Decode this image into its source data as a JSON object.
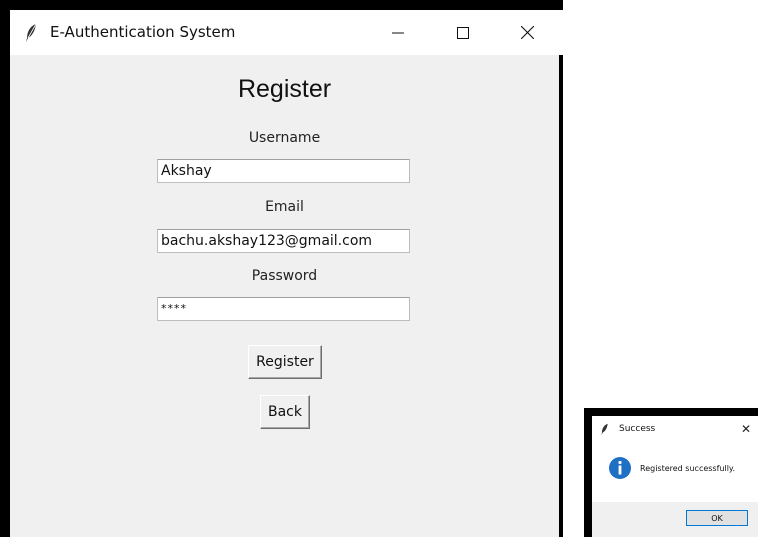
{
  "main_window": {
    "title": "E-Authentication System",
    "heading": "Register",
    "username_label": "Username",
    "username_value": "Akshay",
    "email_label": "Email",
    "email_value": "bachu.akshay123@gmail.com",
    "password_label": "Password",
    "password_value": "****",
    "register_button": "Register",
    "back_button": "Back",
    "icons": [
      "feather-icon",
      "minimize-icon",
      "maximize-icon",
      "close-icon"
    ]
  },
  "dialog": {
    "title": "Success",
    "message": "Registered successfully.",
    "ok_button": "OK",
    "icons": [
      "feather-icon",
      "close-icon",
      "info-icon"
    ],
    "accent_color": "#1f6fc4"
  }
}
